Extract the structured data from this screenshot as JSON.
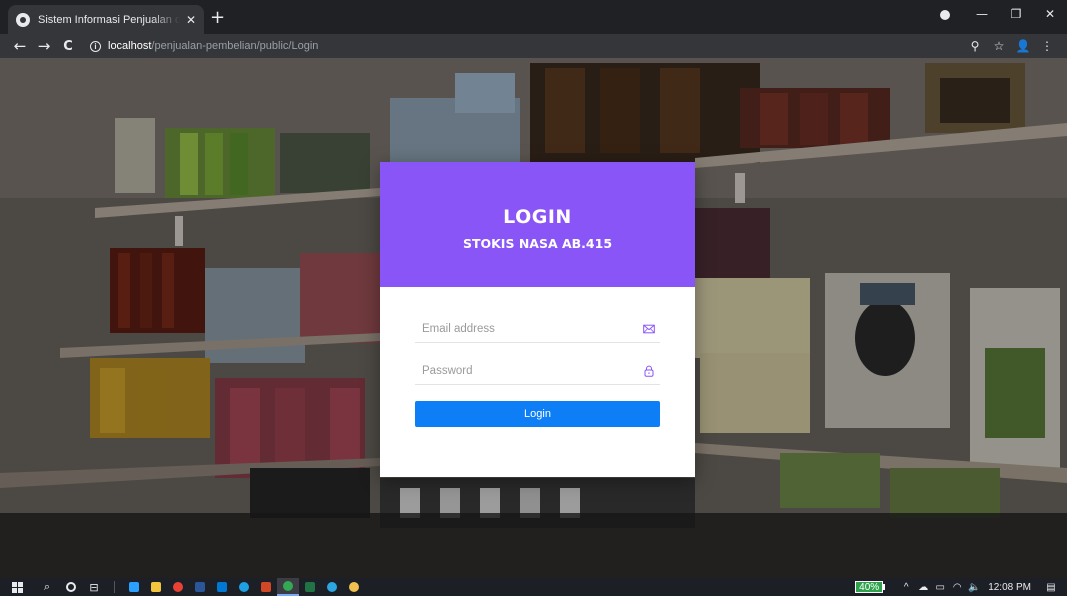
{
  "browser": {
    "tab_title": "Sistem Informasi Penjualan dan Pembelian",
    "tab_close": "✕",
    "new_tab": "+",
    "url_host": "localhost",
    "url_path": "/penjualan-pembelian/public/Login",
    "info_glyph": "i",
    "back": "←",
    "forward": "→",
    "reload": "C",
    "minimize": "—",
    "restore": "❐",
    "close": "✕",
    "zoom_icon": "⚲",
    "star_icon": "☆",
    "profile_icon": "👤",
    "menu_icon": "⋮"
  },
  "login": {
    "title": "LOGIN",
    "subtitle": "STOKIS NASA AB.415",
    "email_placeholder": "Email address",
    "password_placeholder": "Password",
    "button_label": "Login",
    "header_color": "#8a55f7",
    "button_color": "#0d7ef5"
  },
  "taskbar": {
    "search_glyph": "⌕",
    "taskview_glyph": "⊟",
    "apps": [
      {
        "name": "l-app",
        "color": "#2aa1ff"
      },
      {
        "name": "file-explorer",
        "color": "#f3c53f"
      },
      {
        "name": "chrome",
        "color": "#e94235"
      },
      {
        "name": "word",
        "color": "#2b579a"
      },
      {
        "name": "vscode",
        "color": "#0078d4"
      },
      {
        "name": "edge",
        "color": "#1fa0e3"
      },
      {
        "name": "powerpoint",
        "color": "#d24726"
      },
      {
        "name": "chrome-active",
        "color": "#34a853"
      },
      {
        "name": "excel",
        "color": "#217346"
      },
      {
        "name": "telegram",
        "color": "#2ca5e0"
      },
      {
        "name": "other-app",
        "color": "#f2c14e"
      }
    ],
    "battery": "40%",
    "chevron": "^",
    "cloud": "☁",
    "display": "▭",
    "wifi": "◠",
    "volume": "🔈",
    "time": "12:08 PM",
    "notification": "▤"
  }
}
